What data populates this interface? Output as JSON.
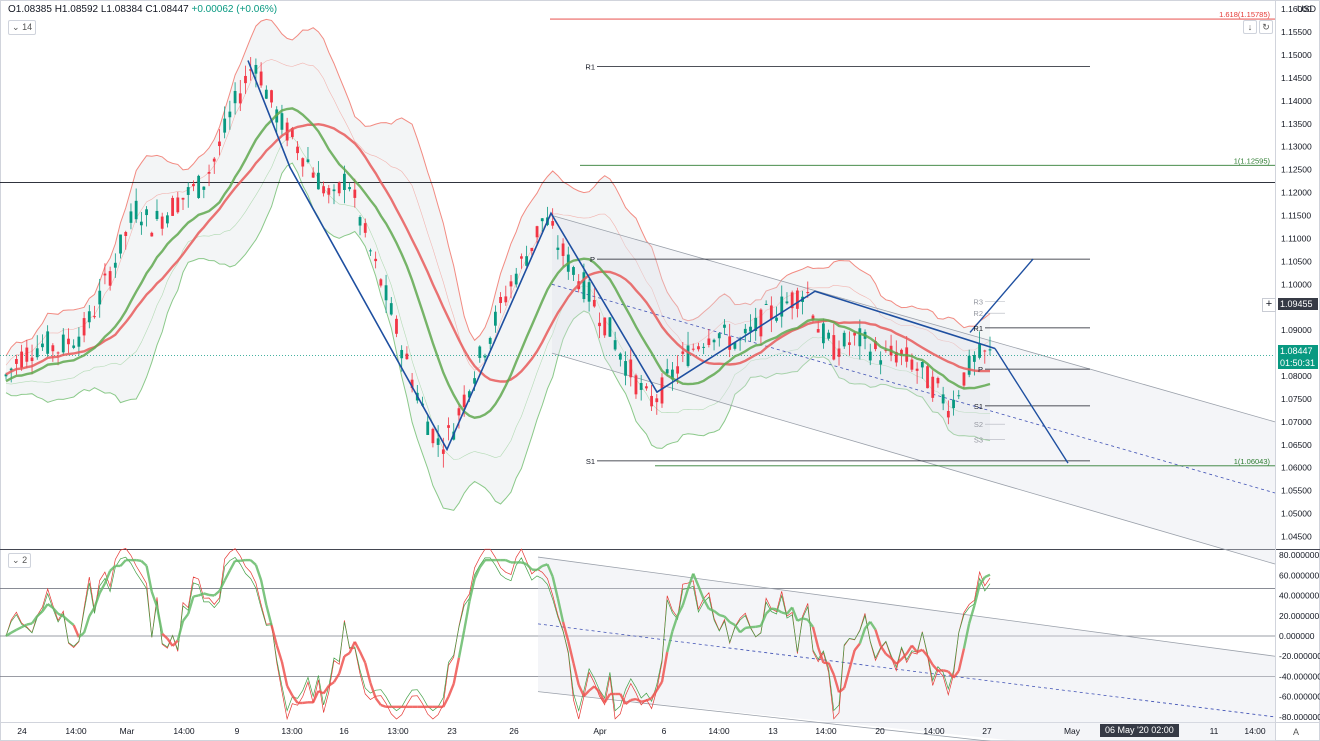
{
  "header": {
    "ohlc_text": "O1.08385 H1.08592 L1.08384 C1.08447",
    "change_text": "+0.00062 (+0.06%)",
    "indicator_badge": "14",
    "pane2_badge": "2",
    "currency": "USD"
  },
  "price_tags": {
    "last_price": "1.08447",
    "countdown": "01:50:31",
    "crosshair_price": "1.09455"
  },
  "date_tag": "06 May '20  02:00",
  "colors": {
    "up": "#26a69a",
    "down": "#ef5350",
    "candle_up": "#089981",
    "candle_down": "#f23645",
    "pattern": "#1e4fa0",
    "ema": "#e85a5a",
    "sma": "#5fa84f",
    "band_red": "#f28b82",
    "band_green": "#8bc98a",
    "channel": "#9aa0aa",
    "fib": "#2e7d32"
  },
  "chart_data": {
    "type": "candlestick",
    "symbol_quote": "USD",
    "main_pane": {
      "y_ticks": [
        "1.04500",
        "1.05000",
        "1.05500",
        "1.06000",
        "1.06500",
        "1.07000",
        "1.07500",
        "1.08000",
        "1.08500",
        "1.09000",
        "1.09500",
        "1.10000",
        "1.10500",
        "1.11000",
        "1.11500",
        "1.12000",
        "1.12500",
        "1.13000",
        "1.13500",
        "1.14000",
        "1.14500",
        "1.15000",
        "1.15500",
        "1.16000"
      ],
      "ylim": [
        1.0425,
        1.162
      ],
      "close_path": [
        1.08,
        1.084,
        1.086,
        1.087,
        1.086,
        1.088,
        1.09,
        1.096,
        1.103,
        1.11,
        1.117,
        1.113,
        1.115,
        1.118,
        1.12,
        1.122,
        1.128,
        1.136,
        1.143,
        1.149,
        1.141,
        1.135,
        1.131,
        1.127,
        1.122,
        1.118,
        1.124,
        1.114,
        1.105,
        1.097,
        1.088,
        1.079,
        1.071,
        1.065,
        1.068,
        1.076,
        1.083,
        1.09,
        1.097,
        1.103,
        1.108,
        1.115,
        1.109,
        1.104,
        1.1,
        1.095,
        1.09,
        1.084,
        1.079,
        1.074,
        1.077,
        1.081,
        1.085,
        1.088,
        1.09,
        1.088,
        1.087,
        1.09,
        1.093,
        1.095,
        1.097,
        1.099,
        1.09,
        1.086,
        1.087,
        1.088,
        1.086,
        1.084,
        1.085,
        1.083,
        1.08,
        1.077,
        1.073,
        1.08,
        1.084,
        1.0845
      ],
      "labels": [
        {
          "text": "R1",
          "value": 1.1475
        },
        {
          "text": "P",
          "value": 1.1055
        },
        {
          "text": "S1",
          "value": 1.0615
        },
        {
          "text": "R1",
          "value": 1.0905
        },
        {
          "text": "P",
          "value": 1.0815
        },
        {
          "text": "S1",
          "value": 1.0735
        },
        {
          "text": "R3",
          "value": 1.0962
        },
        {
          "text": "R2",
          "value": 1.0937
        },
        {
          "text": "S2",
          "value": 1.0695
        },
        {
          "text": "S3",
          "value": 1.0662
        }
      ],
      "fib_levels": [
        {
          "text": "1.618(1.15785)",
          "value": 1.15785
        },
        {
          "text": "1(1.12595)",
          "value": 1.12595
        },
        {
          "text": "1(1.06043)",
          "value": 1.06043
        }
      ],
      "horizontal_lines": [
        1.1222,
        1.0845
      ]
    },
    "oscillator_pane": {
      "y_ticks": [
        "80.000000",
        "60.000000",
        "40.000000",
        "20.000000",
        "0.000000",
        "-20.000000",
        "-40.000000",
        "-60.000000",
        "-80.000000"
      ],
      "ylim": [
        -85,
        85
      ],
      "levels": [
        47,
        0,
        -40
      ]
    },
    "x_ticks": [
      "24",
      "14:00",
      "Mar",
      "14:00",
      "9",
      "13:00",
      "16",
      "13:00",
      "23",
      "26",
      "Apr",
      "6",
      "14:00",
      "13",
      "14:00",
      "20",
      "14:00",
      "27",
      "May",
      "11",
      "14:00"
    ]
  }
}
